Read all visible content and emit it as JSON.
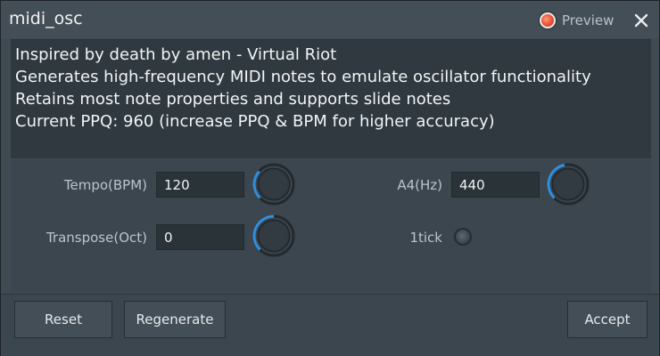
{
  "window": {
    "title": "midi_osc"
  },
  "header": {
    "preview_label": "Preview"
  },
  "description": {
    "lines": [
      "Inspired by death by amen - Virtual Riot",
      "Generates high-frequency MIDI notes to emulate oscillator functionality",
      "Retains most note properties and supports slide notes",
      "Current PPQ: 960 (increase PPQ & BPM for higher accuracy)"
    ]
  },
  "params": {
    "tempo": {
      "label": "Tempo(BPM)",
      "value": "120"
    },
    "a4": {
      "label": "A4(Hz)",
      "value": "440"
    },
    "transpose": {
      "label": "Transpose(Oct)",
      "value": "0"
    },
    "onetick": {
      "label": "1tick"
    }
  },
  "buttons": {
    "reset": "Reset",
    "regenerate": "Regenerate",
    "accept": "Accept"
  },
  "colors": {
    "accent": "#2f8fe0",
    "preview_led": "#f05a3a",
    "background": "#3f4a52",
    "text_area": "#2f393f"
  }
}
